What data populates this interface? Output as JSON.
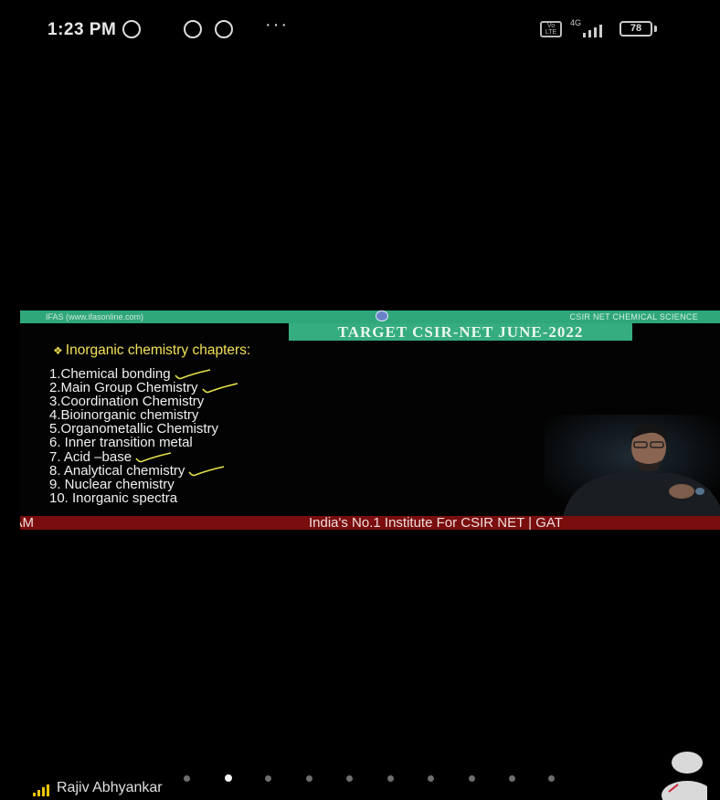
{
  "status_bar": {
    "time": "1:23 PM",
    "more": "···",
    "network": "4G",
    "battery": "78"
  },
  "video": {
    "source": "IFAS (www.ifasonline.com)",
    "channel_label": "CSIR NET CHEMICAL SCIENCE",
    "banner": "TARGET CSIR-NET JUNE-2022",
    "heading_bullet": "❖",
    "heading": "Inorganic  chemistry chapters:",
    "chapters": [
      {
        "label": "1.Chemical bonding",
        "ticked": true
      },
      {
        "label": "2.Main Group Chemistry",
        "ticked": true
      },
      {
        "label": "3.Coordination Chemistry",
        "ticked": false
      },
      {
        "label": "4.Bioinorganic chemistry",
        "ticked": false
      },
      {
        "label": "5.Organometallic Chemistry",
        "ticked": false
      },
      {
        "label": "6. Inner transition metal",
        "ticked": false
      },
      {
        "label": "7. Acid –base",
        "ticked": true
      },
      {
        "label": "8. Analytical chemistry",
        "ticked": true
      },
      {
        "label": "9. Nuclear chemistry",
        "ticked": false
      },
      {
        "label": "10. Inorganic spectra",
        "ticked": false
      }
    ],
    "ticker_left": "-JAM",
    "ticker_right": "India's No.1 Institute For CSIR NET | GAT"
  },
  "footer": {
    "user_name": "Rajiv Abhyankar",
    "page_count": 10,
    "active_page": 1
  },
  "colors": {
    "banner_green": "#36ad80",
    "heading_yellow": "#f3e15a",
    "ticker_red": "#7a0d0d",
    "tick_yellow": "#e6e24a"
  }
}
